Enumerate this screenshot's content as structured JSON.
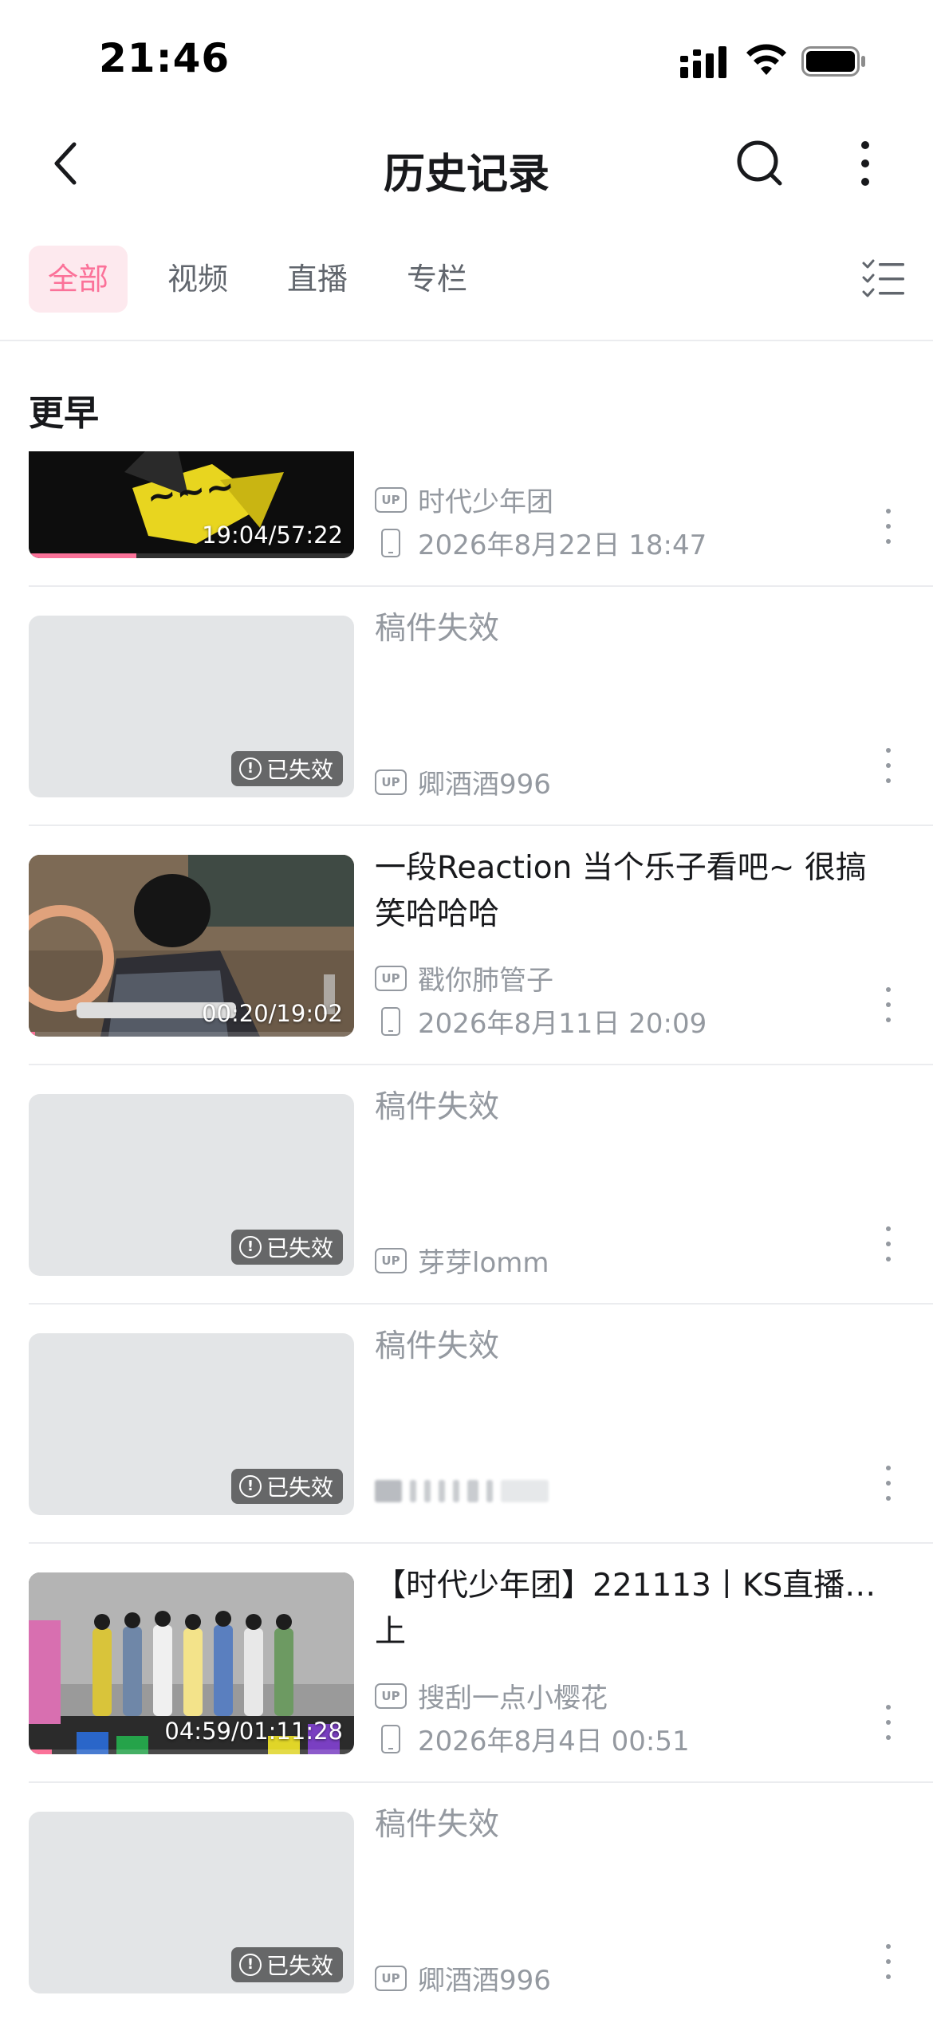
{
  "status_bar": {
    "time": "21:46",
    "icons": [
      "signal-icon",
      "wifi-icon",
      "battery-icon"
    ]
  },
  "nav": {
    "title": "历史记录",
    "icons": [
      "back-icon",
      "search-icon",
      "more-icon"
    ]
  },
  "tabs": [
    {
      "label": "全部",
      "active": true
    },
    {
      "label": "视频",
      "active": false
    },
    {
      "label": "直播",
      "active": false
    },
    {
      "label": "专栏",
      "active": false
    }
  ],
  "section_header": "更早",
  "colors": {
    "accent": "#fb7299",
    "accent_bg": "#fde9ee",
    "text_primary": "#18191c",
    "text_secondary": "#9499a0",
    "placeholder": "#e3e5e7",
    "divider": "#ebecef"
  },
  "items": [
    {
      "title": "",
      "uploader": "时代少年团",
      "watched_at": "2026年8月22日 18:47",
      "duration": "19:04/57:22",
      "progress": 0.33,
      "invalid": false,
      "thumbnail": "stage-yellow"
    },
    {
      "title": "稿件失效",
      "uploader": "卿酒酒996",
      "badge": "已失效",
      "invalid": true
    },
    {
      "title": "一段Reaction 当个乐子看吧~ 很搞笑哈哈哈",
      "uploader": "戳你肺管子",
      "watched_at": "2026年8月11日 20:09",
      "duration": "00:20/19:02",
      "progress": 0.02,
      "invalid": false,
      "thumbnail": "room-person"
    },
    {
      "title": "稿件失效",
      "uploader": "芽芽lomm",
      "badge": "已失效",
      "invalid": true
    },
    {
      "title": "稿件失效",
      "uploader": "",
      "badge": "已失效",
      "invalid": true,
      "uploader_blurred": true
    },
    {
      "title": "【时代少年团】221113丨KS直播…上",
      "uploader": "搜刮一点小樱花",
      "watched_at": "2026年8月4日 00:51",
      "duration": "04:59/01:11:28",
      "progress": 0.07,
      "invalid": false,
      "thumbnail": "group-stage"
    },
    {
      "title": "稿件失效",
      "uploader": "卿酒酒996",
      "badge": "已失效",
      "invalid": true
    }
  ]
}
